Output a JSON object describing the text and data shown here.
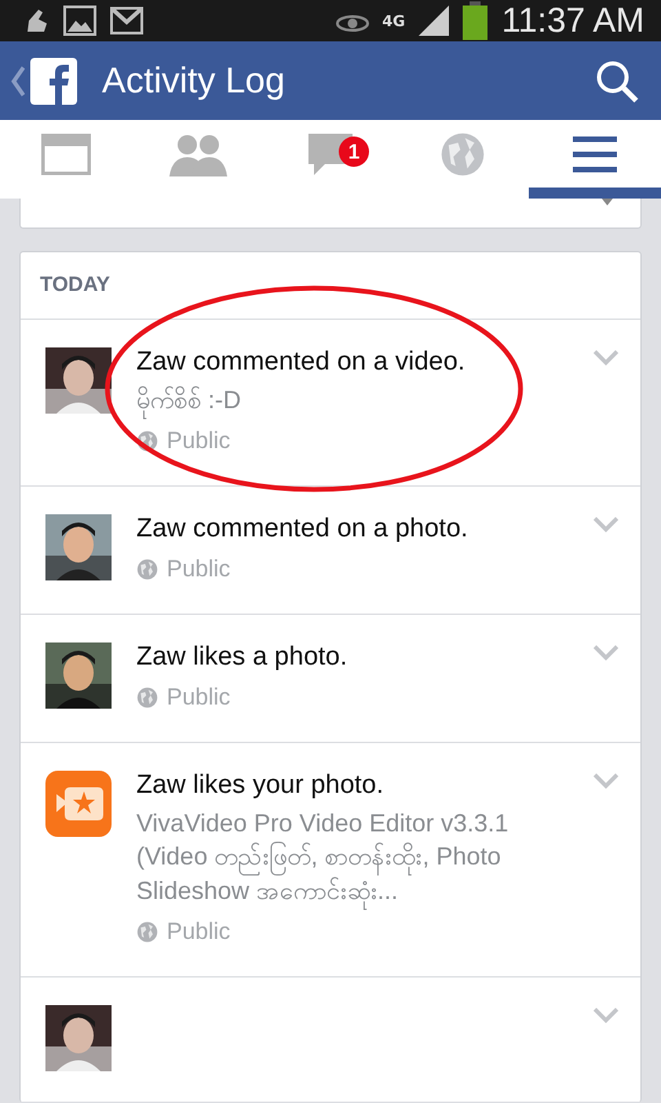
{
  "status_bar": {
    "network": "4G",
    "time": "11:37 AM"
  },
  "header": {
    "title": "Activity Log"
  },
  "tabs": [
    {
      "kind": "feed",
      "selected": false
    },
    {
      "kind": "friends",
      "selected": false
    },
    {
      "kind": "messages",
      "selected": false,
      "badge": "1"
    },
    {
      "kind": "notifications",
      "selected": false
    },
    {
      "kind": "menu",
      "selected": true
    }
  ],
  "section": {
    "title": "TODAY"
  },
  "activities": [
    {
      "kind": "avatar",
      "circled": true,
      "text": "Zaw commented on a video.",
      "detail": "မိုက်စိစ် :-D",
      "privacy": "Public"
    },
    {
      "kind": "avatar",
      "circled": false,
      "text": "Zaw commented on a photo.",
      "privacy": "Public"
    },
    {
      "kind": "avatar",
      "circled": false,
      "text": "Zaw likes a photo.",
      "privacy": "Public"
    },
    {
      "kind": "app",
      "circled": false,
      "text": "Zaw likes your photo.",
      "detail": "VivaVideo Pro Video Editor v3.3.1 (Video တည်းဖြတ်, စာတန်းထိုး, Photo Slideshow အကောင်းဆုံး...",
      "privacy": "Public"
    },
    {
      "kind": "avatar",
      "circled": false
    }
  ]
}
